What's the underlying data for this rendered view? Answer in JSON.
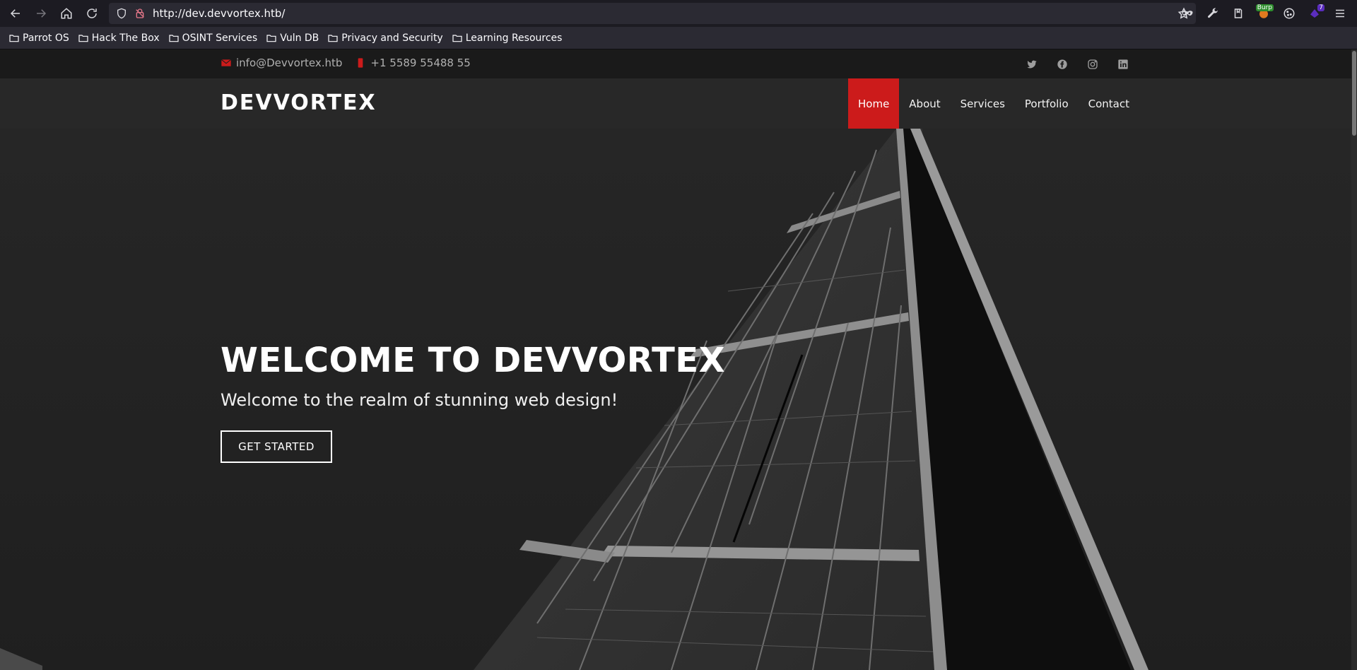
{
  "browser": {
    "url": "http://dev.devvortex.htb/",
    "extensions": [
      {
        "name": "private-browsing-icon"
      },
      {
        "name": "wrench-icon"
      },
      {
        "name": "extensions-icon"
      },
      {
        "name": "burp-extension-icon",
        "badge": "Burp",
        "badge_color": "#2f8f2f"
      },
      {
        "name": "cookie-icon"
      },
      {
        "name": "purple-extension-icon",
        "badge": "7",
        "badge_color": "#5b2dbf"
      },
      {
        "name": "hamburger-menu-icon"
      }
    ]
  },
  "bookmarks": [
    {
      "label": "Parrot OS"
    },
    {
      "label": "Hack The Box"
    },
    {
      "label": "OSINT Services"
    },
    {
      "label": "Vuln DB"
    },
    {
      "label": "Privacy and Security"
    },
    {
      "label": "Learning Resources"
    }
  ],
  "site": {
    "email": "info@Devvortex.htb",
    "phone": "+1 5589 55488 55",
    "socials": [
      "twitter-icon",
      "facebook-icon",
      "instagram-icon",
      "linkedin-icon"
    ],
    "logo": "DEVVORTEX",
    "nav": [
      {
        "label": "Home",
        "active": true
      },
      {
        "label": "About"
      },
      {
        "label": "Services"
      },
      {
        "label": "Portfolio"
      },
      {
        "label": "Contact"
      }
    ],
    "hero": {
      "title": "WELCOME TO DEVVORTEX",
      "subtitle": "Welcome to the realm of stunning web design!",
      "cta": "GET STARTED"
    },
    "colors": {
      "accent": "#cc1b1b",
      "topbar": "#1a1a1a",
      "navbar": "#282828"
    }
  }
}
